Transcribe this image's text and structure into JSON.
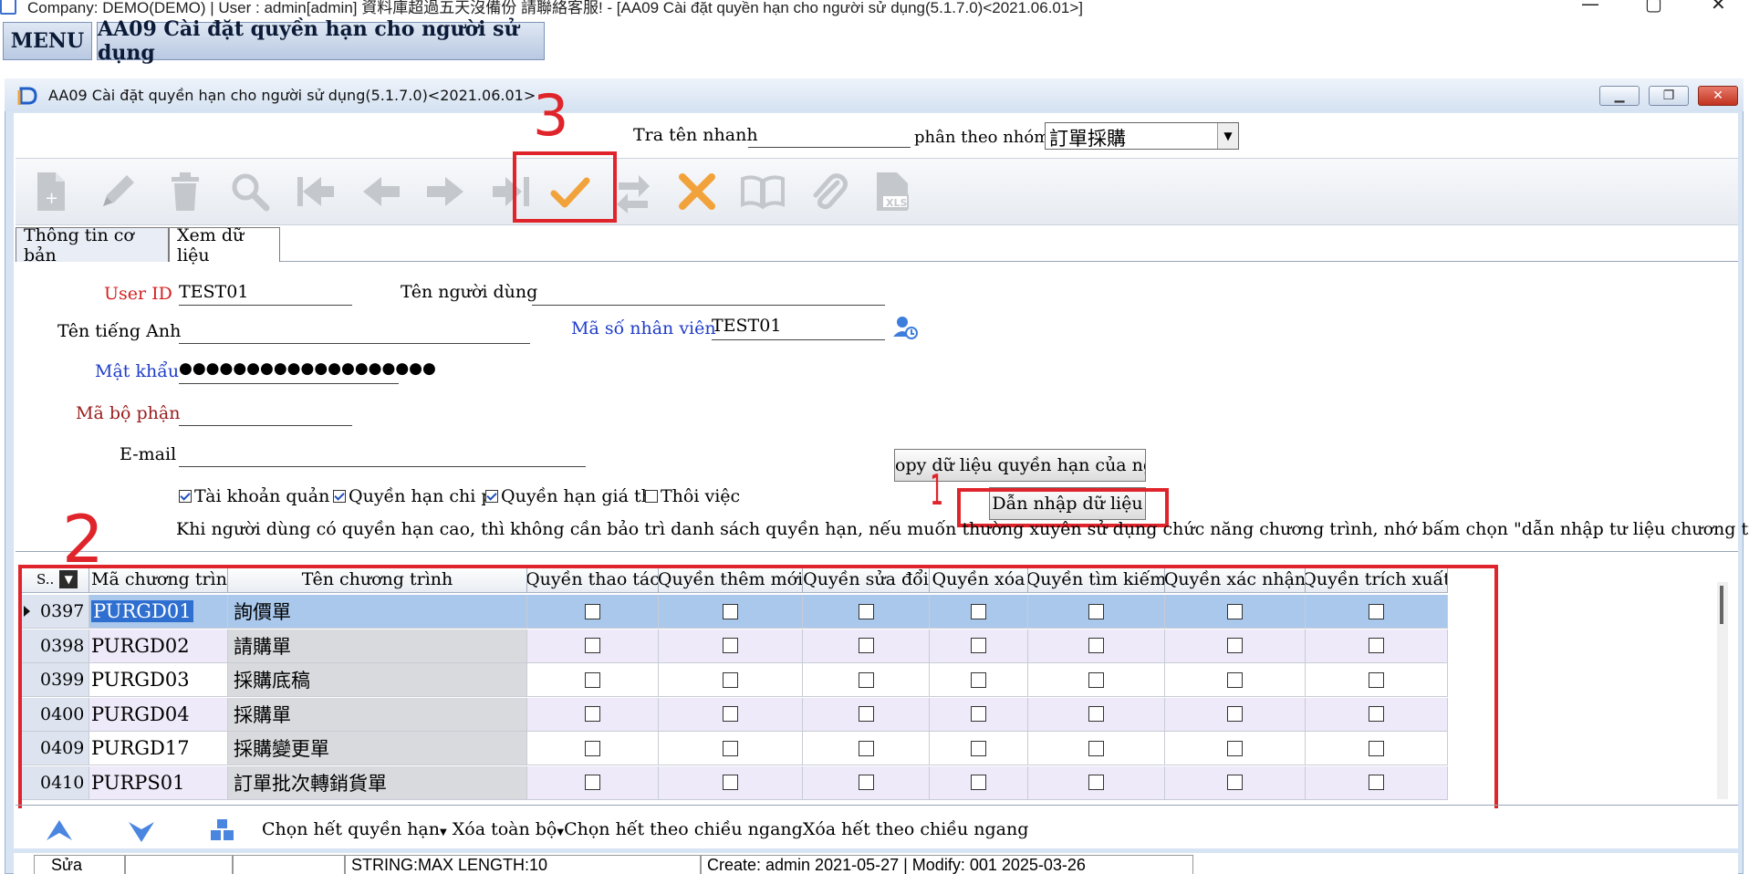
{
  "window": {
    "title": "Company: DEMO(DEMO) | User : admin[admin] 資料庫超過五天沒備份 請聯絡客服! - [AA09 Cài đặt quyền hạn cho người sử dụng(5.1.7.0)<2021.06.01>]",
    "minimize_icon": "minimize-icon",
    "restore_icon": "restore-icon",
    "close_icon": "close-icon"
  },
  "menubar": {
    "menu_label": "MENU",
    "module_tab": "AA09 Cài đặt quyền hạn cho người sử dụng"
  },
  "inner_window": {
    "title": "AA09 Cài đặt quyền hạn cho người sử dụng(5.1.7.0)<2021.06.01>"
  },
  "search": {
    "quick_search_label": "Tra tên nhanh",
    "quick_search_value": "",
    "group_label": "phân theo nhóm",
    "group_value": "訂單採購"
  },
  "toolbar": {
    "icons": [
      "new-doc-icon",
      "edit-icon",
      "delete-icon",
      "search-icon",
      "first-record-icon",
      "prev-record-icon",
      "next-record-icon",
      "last-record-icon",
      "confirm-icon",
      "transfer-icon",
      "cancel-icon",
      "manual-icon",
      "attach-icon",
      "excel-icon"
    ],
    "confirm_color": "#f2a23a",
    "cancel_color": "#f2a23a"
  },
  "tabs": [
    "Thông tin cơ bản",
    "Xem dữ liệu"
  ],
  "form": {
    "user_id_label": "User ID",
    "user_id_value": "TEST01",
    "user_name_label": "Tên người dùng",
    "user_name_value": "",
    "english_name_label": "Tên tiếng Anh",
    "english_name_value": "",
    "employee_code_label": "Mã số nhân viên",
    "employee_code_value": "TEST01",
    "password_label": "Mật khẩu",
    "password_value": "●●●●●●●●●●●●●●●●●●●",
    "department_label": "Mã bộ phận",
    "department_value": "",
    "email_label": "E-mail",
    "email_value": "",
    "copy_button": "opy dữ liệu quyền hạn của người",
    "import_button": "Dẫn nhập dữ liệu",
    "checkbox_admin": "Tài khoản quản lý",
    "checkbox_cost": "Quyền hạn chi p",
    "checkbox_price": "Quyền hạn giá thà",
    "checkbox_resign": "Thôi việc",
    "hint": "Khi người dùng có quyền hạn cao, thì không cần bảo trì danh sách quyền hạn, nếu muốn thường xuyên sử dụng chức năng chương trình, nhớ bấm chọn \"dẫn nhập tư liệu chương trình\""
  },
  "grid": {
    "first_header": "S..",
    "headers": [
      "Mã chương trình",
      "Tên chương trình",
      "Quyền thao tác",
      "Quyền thêm mới",
      "Quyền sửa đổi",
      "Quyền xóa",
      "Quyền tìm kiếm",
      "Quyền xác nhận",
      "Quyền trích xuất"
    ],
    "rows": [
      {
        "seq": "0397",
        "code": "PURGD01",
        "name": "詢價單"
      },
      {
        "seq": "0398",
        "code": "PURGD02",
        "name": "請購單"
      },
      {
        "seq": "0399",
        "code": "PURGD03",
        "name": "採購底稿"
      },
      {
        "seq": "0400",
        "code": "PURGD04",
        "name": "採購單"
      },
      {
        "seq": "0409",
        "code": "PURGD17",
        "name": "採購變更單"
      },
      {
        "seq": "0410",
        "code": "PURPS01",
        "name": "訂單批次轉銷貨單"
      }
    ]
  },
  "bottom": {
    "select_all": "Chọn hết quyền hạn",
    "clear_all": "Xóa toàn bộ",
    "select_horizontal": "Chọn hết theo chiều ngang",
    "clear_horizontal": "Xóa hết theo chiều ngang"
  },
  "status": {
    "mode": "Sửa",
    "field_info": "STRING:MAX LENGTH:10",
    "record_info": "Create: admin 2021-05-27 | Modify: 001 2025-03-26"
  },
  "annotations": {
    "mark_1": "1",
    "mark_2": "2",
    "mark_3": "3"
  }
}
